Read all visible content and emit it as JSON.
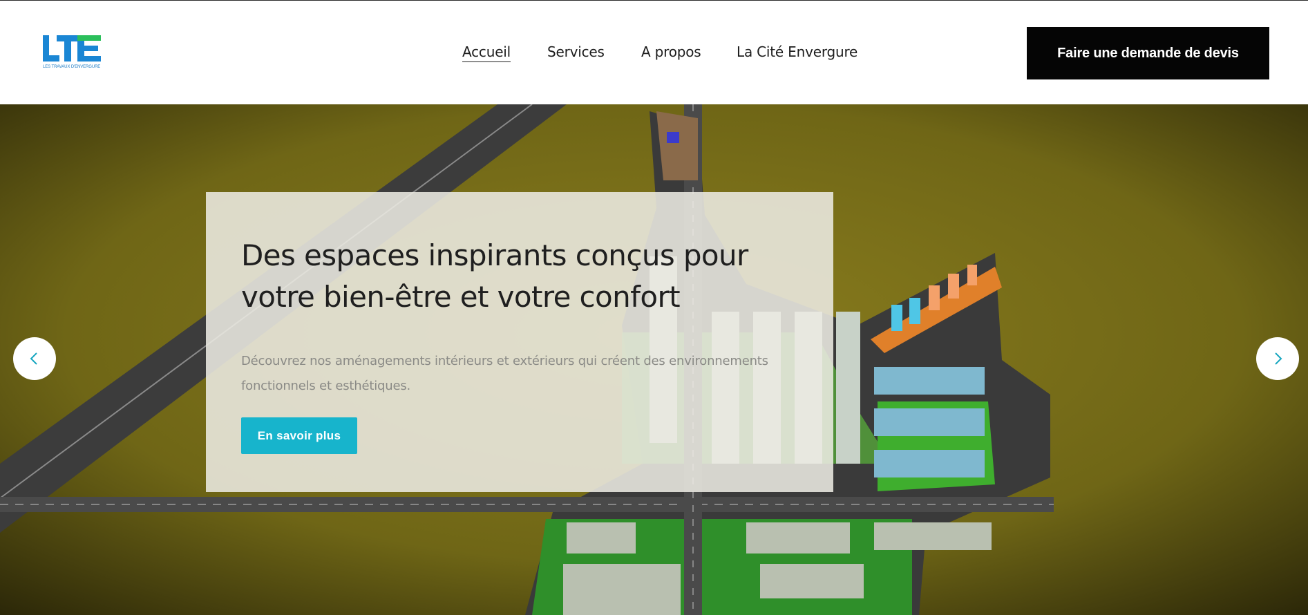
{
  "brand": {
    "logo_text": "LTE",
    "logo_caption": "LES TRAVAUX D'ENVERGURE",
    "color": "#1a86d4"
  },
  "nav": {
    "items": [
      {
        "label": "Accueil",
        "active": true
      },
      {
        "label": "Services",
        "active": false
      },
      {
        "label": "A propos",
        "active": false
      },
      {
        "label": "La Cité Envergure",
        "active": false
      }
    ]
  },
  "header": {
    "cta_label": "Faire une demande de devis"
  },
  "hero": {
    "title": "Des espaces inspirants conçus pour votre bien-être et votre confort",
    "description": "Découvrez nos aménagements intérieurs et extérieurs qui créent des environnements fonctionnels et esthétiques.",
    "button_label": "En savoir plus",
    "accent_color": "#17b4cc",
    "prev_icon": "chevron-left-icon",
    "next_icon": "chevron-right-icon"
  }
}
